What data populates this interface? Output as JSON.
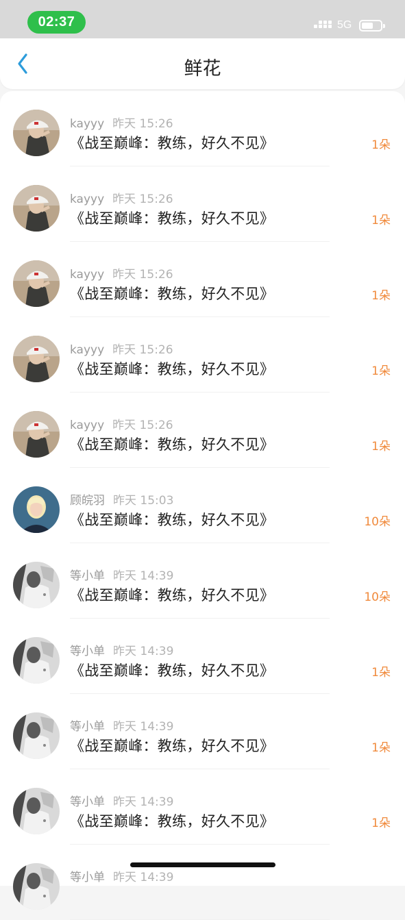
{
  "status_bar": {
    "time": "02:37",
    "network": "5G"
  },
  "nav": {
    "title": "鲜花"
  },
  "colors": {
    "accent": "#2d9cdb",
    "count": "#f08a3c",
    "time_pill": "#2fbf4b"
  },
  "items": [
    {
      "user": "kayyy",
      "time": "昨天 15:26",
      "title": "《战至巅峰：教练，好久不见》",
      "count": "1朵",
      "avatar": "cap-avatar"
    },
    {
      "user": "kayyy",
      "time": "昨天 15:26",
      "title": "《战至巅峰：教练，好久不见》",
      "count": "1朵",
      "avatar": "cap-avatar"
    },
    {
      "user": "kayyy",
      "time": "昨天 15:26",
      "title": "《战至巅峰：教练，好久不见》",
      "count": "1朵",
      "avatar": "cap-avatar"
    },
    {
      "user": "kayyy",
      "time": "昨天 15:26",
      "title": "《战至巅峰：教练，好久不见》",
      "count": "1朵",
      "avatar": "cap-avatar"
    },
    {
      "user": "kayyy",
      "time": "昨天 15:26",
      "title": "《战至巅峰：教练，好久不见》",
      "count": "1朵",
      "avatar": "cap-avatar"
    },
    {
      "user": "顾皖羽",
      "time": "昨天 15:03",
      "title": "《战至巅峰：教练，好久不见》",
      "count": "10朵",
      "avatar": "blonde-avatar"
    },
    {
      "user": "等小单",
      "time": "昨天 14:39",
      "title": "《战至巅峰：教练，好久不见》",
      "count": "10朵",
      "avatar": "gray-avatar"
    },
    {
      "user": "等小单",
      "time": "昨天 14:39",
      "title": "《战至巅峰：教练，好久不见》",
      "count": "1朵",
      "avatar": "gray-avatar"
    },
    {
      "user": "等小单",
      "time": "昨天 14:39",
      "title": "《战至巅峰：教练，好久不见》",
      "count": "1朵",
      "avatar": "gray-avatar"
    },
    {
      "user": "等小单",
      "time": "昨天 14:39",
      "title": "《战至巅峰：教练，好久不见》",
      "count": "1朵",
      "avatar": "gray-avatar"
    },
    {
      "user": "等小单",
      "time": "昨天 14:39",
      "title": "",
      "count": "",
      "avatar": "gray-avatar"
    }
  ]
}
